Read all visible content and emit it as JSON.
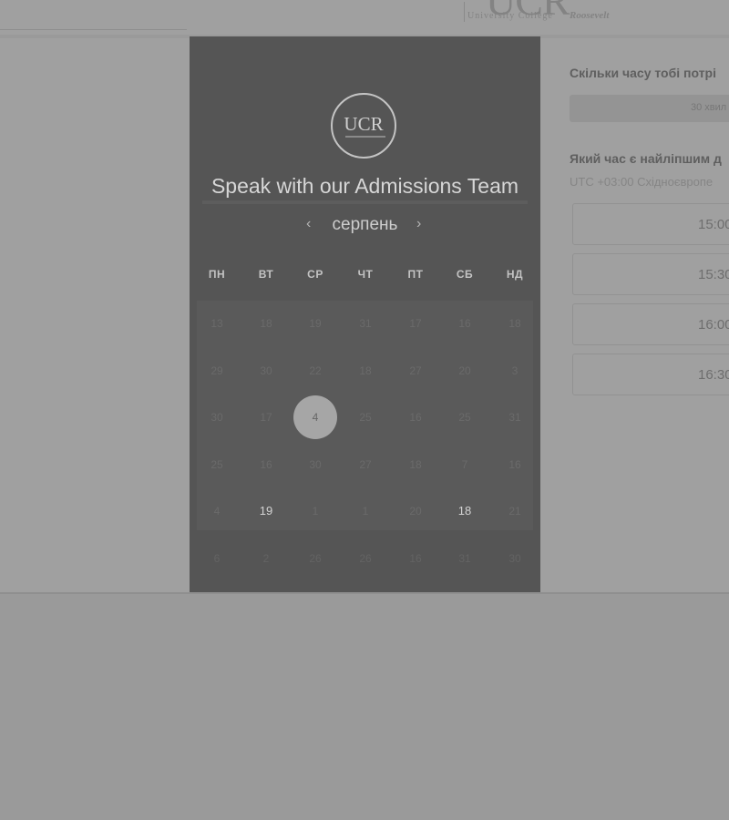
{
  "header": {
    "logo": {
      "mark": "UCR",
      "line1": "University College",
      "line2": "Roosevelt"
    }
  },
  "scheduler": {
    "duration_question": "Скільки часу тобі потрі",
    "duration_value": "30 хвил",
    "time_question": "Який час є найліпшим д",
    "timezone": "UTC +03:00 Східноєвропе",
    "slots": [
      "15:00",
      "15:30",
      "16:00",
      "16:30"
    ]
  },
  "modal": {
    "logo_text": "UCR",
    "title": "Speak with our Admissions Team",
    "month": "серпень",
    "prev_icon": "chevron-left-icon",
    "next_icon": "chevron-right-icon",
    "weekdays": [
      "ПН",
      "ВТ",
      "СР",
      "ЧТ",
      "ПТ",
      "СБ",
      "НД"
    ],
    "weeks": [
      [
        "13",
        "18",
        "19",
        "31",
        "17",
        "16",
        "18"
      ],
      [
        "29",
        "30",
        "22",
        "18",
        "27",
        "20",
        "3"
      ],
      [
        "30",
        "17",
        "4",
        "25",
        "16",
        "25",
        "31"
      ],
      [
        "25",
        "16",
        "30",
        "27",
        "18",
        "7",
        "16"
      ],
      [
        "4",
        "19",
        "1",
        "1",
        "20",
        "18",
        "21"
      ],
      [
        "6",
        "2",
        "26",
        "26",
        "16",
        "31",
        "30"
      ]
    ],
    "selected_day": "4",
    "available_days": [
      "19",
      "18"
    ]
  }
}
